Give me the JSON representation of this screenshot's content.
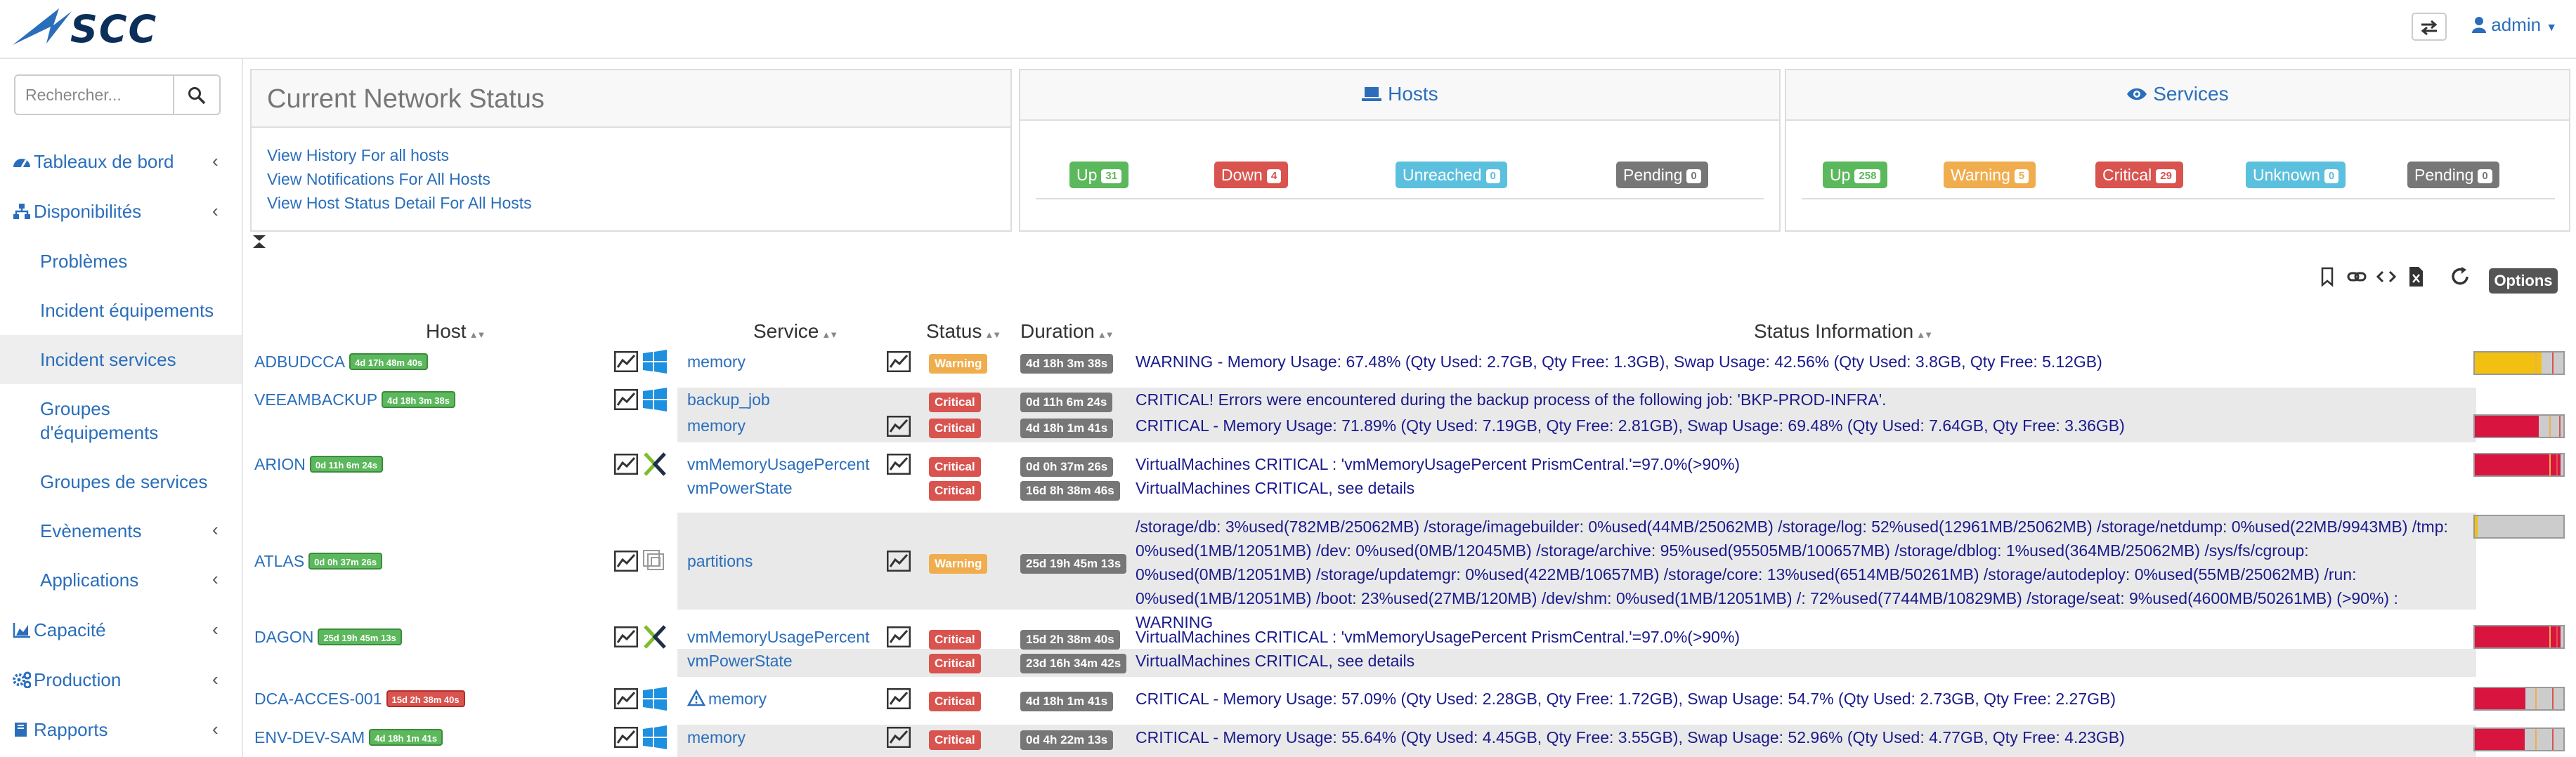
{
  "brand": "SCC",
  "user": {
    "name": "admin"
  },
  "search": {
    "placeholder": "Rechercher..."
  },
  "menu": [
    {
      "label": "Tableaux de bord",
      "icon": "dashboard-icon"
    },
    {
      "label": "Disponibilités",
      "icon": "sitemap-icon"
    },
    {
      "label": "Problèmes"
    },
    {
      "label": "Incident équipements"
    },
    {
      "label": "Incident services"
    },
    {
      "label": "Groupes d'équipements"
    },
    {
      "label": "Groupes de services"
    },
    {
      "label": "Evènements"
    },
    {
      "label": "Applications"
    },
    {
      "label": "Capacité",
      "icon": "chart-icon"
    },
    {
      "label": "Production",
      "icon": "cogs-icon"
    },
    {
      "label": "Rapports",
      "icon": "book-icon"
    }
  ],
  "network_status": {
    "title": "Current Network Status",
    "links": [
      "View History For all hosts",
      "View Notifications For All Hosts",
      "View Host Status Detail For All Hosts"
    ]
  },
  "hosts": {
    "title": "Hosts",
    "up_label": "Up",
    "up": "31",
    "down_label": "Down",
    "down": "4",
    "unreached_label": "Unreached",
    "unreached": "0",
    "pending_label": "Pending",
    "pending": "0"
  },
  "services": {
    "title": "Services",
    "up_label": "Up",
    "up": "258",
    "warning_label": "Warning",
    "warning": "5",
    "critical_label": "Critical",
    "critical": "29",
    "unknown_label": "Unknown",
    "unknown": "0",
    "pending_label": "Pending",
    "pending": "0"
  },
  "toolbar": {
    "options_label": "Options"
  },
  "table": {
    "headers": {
      "host": "Host",
      "service": "Service",
      "status": "Status",
      "duration": "Duration",
      "info": "Status Information"
    },
    "rows": [
      {
        "host": "ADBUDCCA",
        "host_dur": "4d 17h 48m 40s",
        "service": "memory",
        "status": "Warning",
        "duration": "4d 18h 3m 38s",
        "info": "WARNING - Memory Usage: 67.48% (Qty Used: 2.7GB, Qty Free: 1.3GB), Swap Usage: 42.56% (Qty Used: 3.8GB, Qty Free: 5.12GB)",
        "level": 0.75
      },
      {
        "host": "VEEAMBACKUP",
        "host_dur": "4d 18h 3m 38s",
        "service": "backup_job",
        "status": "Critical",
        "duration": "0d 11h 6m 24s",
        "info": "CRITICAL! Errors were encountered during the backup process of the following job: 'BKP-PROD-INFRA'."
      },
      {
        "service": "memory",
        "status": "Critical",
        "duration": "4d 18h 1m 41s",
        "info": "CRITICAL - Memory Usage: 71.89% (Qty Used: 7.19GB, Qty Free: 2.81GB), Swap Usage: 69.48% (Qty Used: 7.64GB, Qty Free: 3.36GB)",
        "level": 0.72
      },
      {
        "host": "ARION",
        "host_dur": "0d 11h 6m 24s",
        "service": "vmMemoryUsagePercent",
        "status": "Critical",
        "duration": "0d 0h 37m 26s",
        "info": "VirtualMachines CRITICAL : 'vmMemoryUsagePercent PrismCentral.'=97.0%(>90%)",
        "level": 0.97
      },
      {
        "service": "vmPowerState",
        "status": "Critical",
        "duration": "16d 8h 38m 46s",
        "info": "VirtualMachines CRITICAL, see details"
      },
      {
        "host": "ATLAS",
        "host_dur": "0d 0h 37m 26s",
        "service": "partitions",
        "status": "Warning",
        "duration": "25d 19h 45m 13s",
        "info": "/storage/db: 3%used(782MB/25062MB) /storage/imagebuilder: 0%used(44MB/25062MB) /storage/log: 52%used(12961MB/25062MB) /storage/netdump: 0%used(22MB/9943MB) /tmp: 0%used(1MB/12051MB) /dev: 0%used(0MB/12045MB) /storage/archive: 95%used(95505MB/100657MB) /storage/dblog: 1%used(364MB/25062MB) /sys/fs/cgroup: 0%used(0MB/12051MB) /storage/updatemgr: 0%used(422MB/10657MB) /storage/core: 13%used(6514MB/50261MB) /storage/autodeploy: 0%used(55MB/25062MB) /run: 0%used(1MB/12051MB) /boot: 23%used(27MB/120MB) /dev/shm: 0%used(1MB/12051MB) /: 72%used(7744MB/10829MB) /storage/seat: 9%used(4600MB/50261MB) (>90%) : WARNING",
        "level": 0.03
      },
      {
        "host": "DAGON",
        "host_dur": "25d 19h 45m 13s",
        "service": "vmMemoryUsagePercent",
        "status": "Critical",
        "duration": "15d 2h 38m 40s",
        "info": "VirtualMachines CRITICAL : 'vmMemoryUsagePercent PrismCentral.'=97.0%(>90%)",
        "level": 0.97
      },
      {
        "service": "vmPowerState",
        "status": "Critical",
        "duration": "23d 16h 34m 42s",
        "info": "VirtualMachines CRITICAL, see details"
      },
      {
        "host": "DCA-ACCES-001",
        "host_dur": "15d 2h 38m 40s",
        "service": "memory",
        "status": "Critical",
        "duration": "4d 18h 1m 41s",
        "info": "CRITICAL - Memory Usage: 57.09% (Qty Used: 2.28GB, Qty Free: 1.72GB), Swap Usage: 54.7% (Qty Used: 2.73GB, Qty Free: 2.27GB)",
        "level": 0.57
      },
      {
        "host": "ENV-DEV-SAM",
        "host_dur": "4d 18h 1m 41s",
        "service": "memory",
        "status": "Critical",
        "duration": "0d 4h 22m 13s",
        "info": "CRITICAL - Memory Usage: 55.64% (Qty Used: 4.45GB, Qty Free: 3.55GB), Swap Usage: 52.96% (Qty Used: 4.77GB, Qty Free: 4.23GB)",
        "level": 0.56
      }
    ]
  },
  "colors": {
    "accent": "#2a6ebb",
    "ok": "#5cb85c",
    "warning": "#f0ad4e",
    "critical": "#d9534f",
    "unknown": "#5bc0de",
    "pending": "#777777"
  }
}
